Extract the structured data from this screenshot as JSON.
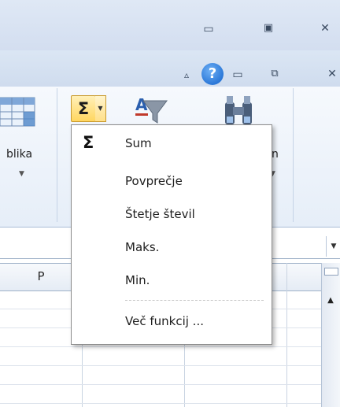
{
  "ribbon": {
    "table_label_partial": "blika",
    "find_label_partial": "n",
    "autosum_symbol": "Σ"
  },
  "grid": {
    "column_header": "P"
  },
  "autosum_menu": {
    "items": [
      {
        "label": "Sum",
        "icon": "Σ"
      },
      {
        "label": "Povprečje",
        "icon": ""
      },
      {
        "label": "Štetje števil",
        "icon": ""
      },
      {
        "label": "Maks.",
        "icon": ""
      },
      {
        "label": "Min.",
        "icon": ""
      },
      {
        "label": "Več funkcij ...",
        "icon": ""
      }
    ]
  },
  "icons": {
    "window_minimize": "minimize-icon",
    "window_restore": "restore-icon",
    "window_close": "close-icon",
    "ribbon_minimize": "chevron-up-icon",
    "help": "help-icon",
    "table": "table-icon",
    "sort_filter": "sort-filter-icon",
    "find_select": "binoculars-icon"
  },
  "colors": {
    "autosum_highlight": "#ffd660",
    "help_blue": "#2b78d8"
  }
}
